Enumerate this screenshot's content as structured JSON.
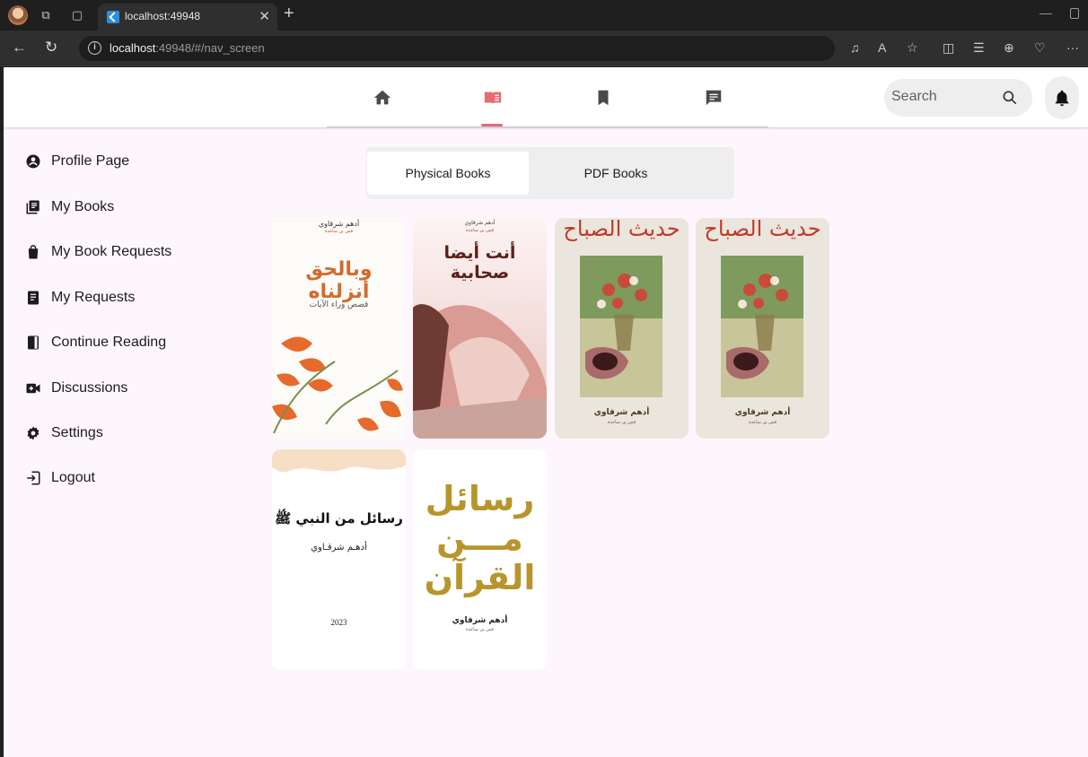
{
  "browser": {
    "tab_title": "localhost:49948",
    "address_host": "localhost",
    "address_path": ":49948/#/nav_screen"
  },
  "header": {
    "search_placeholder": "Search",
    "nav_tabs": [
      "home",
      "books",
      "bookmarks",
      "messages"
    ],
    "active_tab": "books"
  },
  "sidebar": {
    "items": [
      {
        "label": "Profile Page",
        "icon": "profile-icon"
      },
      {
        "label": "My Books",
        "icon": "library-icon"
      },
      {
        "label": "My Book Requests",
        "icon": "shopping-bag-icon"
      },
      {
        "label": "My Requests",
        "icon": "receipt-icon"
      },
      {
        "label": "Continue Reading",
        "icon": "book-icon"
      },
      {
        "label": "Discussions",
        "icon": "video-call-icon"
      },
      {
        "label": "Settings",
        "icon": "gear-icon"
      },
      {
        "label": "Logout",
        "icon": "logout-icon"
      }
    ]
  },
  "segment": {
    "options": [
      "Physical Books",
      "PDF Books"
    ],
    "selected": "Physical Books"
  },
  "books": [
    {
      "title": "وبالحق أنزلناه",
      "subtitle": "قصص وراء الآيات",
      "author": "أدهم شرقاوي",
      "tagline": "قس بن ساعدة"
    },
    {
      "title": "أنت أيضا صحابية",
      "author": "أدهم شرقاوي",
      "tagline": "قس بن ساعدة"
    },
    {
      "title": "حديث الصباح",
      "author": "أدهم شرقاوي",
      "tagline": "قس بن ساعدة"
    },
    {
      "title": "حديث الصباح",
      "author": "أدهم شرقاوي",
      "tagline": "قس بن ساعدة"
    },
    {
      "title": "رسائل من النبي ﷺ",
      "author": "أدهـم شرقـاوي",
      "year": "2023"
    },
    {
      "title_lines": [
        "رسائل",
        "مـــن",
        "القرآن"
      ],
      "author": "أدهم شرقاوي",
      "tagline": "قس بن ساعدة"
    }
  ],
  "colors": {
    "app_bg": "#fdf6fd",
    "accent": "#e46b73",
    "gold": "#b8952c"
  }
}
